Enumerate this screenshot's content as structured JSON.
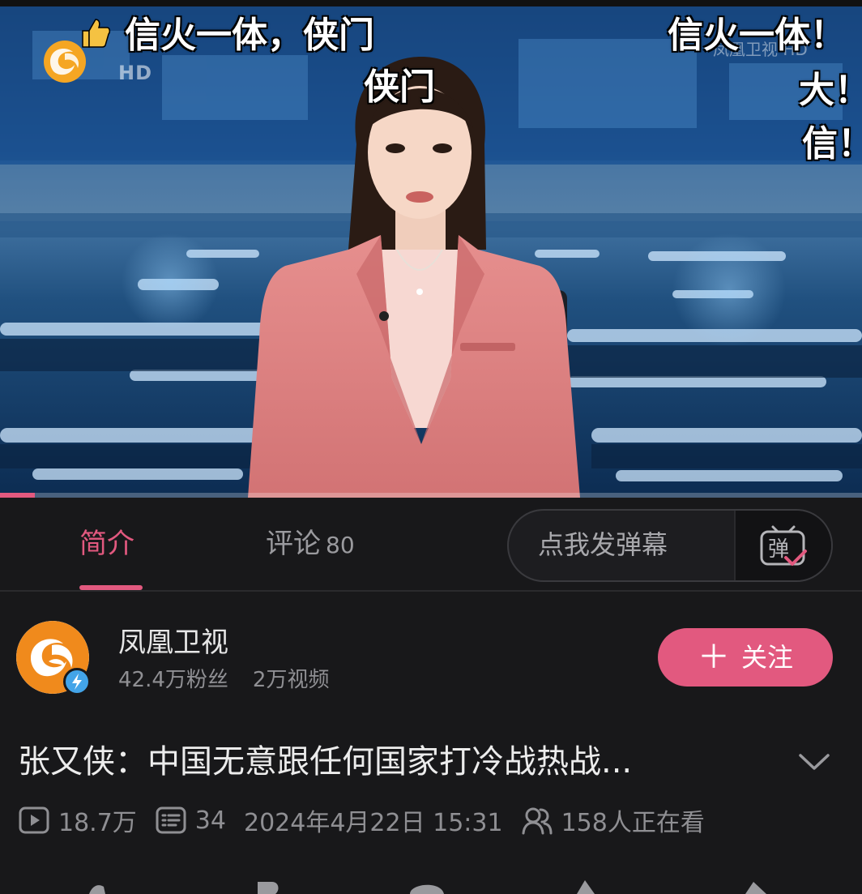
{
  "player": {
    "channel_logo": "phoenix-tv-logo",
    "hd_label": "HD",
    "danmaku": [
      {
        "text": "信火一体，侠门"
      },
      {
        "text": "侠门"
      },
      {
        "text": "信火一体！"
      },
      {
        "text": "大！"
      },
      {
        "text": "信！"
      }
    ],
    "progress": 0.04,
    "accent": "#e2597f"
  },
  "tabs": {
    "intro_label": "简介",
    "comments_label": "评论",
    "comments_count": "80",
    "danmaku_placeholder": "点我发弹幕",
    "danmaku_toggle_icon": "danmaku-toggle-icon",
    "danmaku_toggle_glyph": "弹"
  },
  "uploader": {
    "name": "凤凰卫视",
    "followers": "42.4万粉丝",
    "videos": "2万视频",
    "follow_label": "关注",
    "follow_icon": "plus-icon"
  },
  "video": {
    "title": "张又侠：中国无意跟任何国家打冷战热战...",
    "views": "18.7万",
    "danmaku_count": "34",
    "date": "2024年4月22日 15:31",
    "watching": "158人正在看"
  }
}
